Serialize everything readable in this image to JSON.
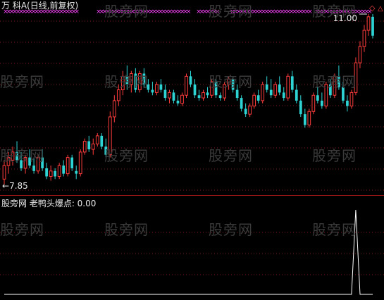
{
  "header": {
    "title": "万 科A(日线,前复权)"
  },
  "indicator": {
    "label": "股旁网 老鸭头爆点: 0.00"
  },
  "watermark": "股旁网",
  "colors": {
    "up": "#ff3c3c",
    "down": "#2ed3d3",
    "grid": "#7a1c1c",
    "marker": "#ff44ff",
    "indicator_line": "#ffffff",
    "divider": "#a01818"
  },
  "chart_data": {
    "type": "candlestick",
    "annotations": {
      "high_label": "11.00",
      "low_label": "7.85"
    },
    "price_range": [
      7.85,
      11.0
    ],
    "candles": [
      {
        "o": 7.95,
        "h": 8.3,
        "l": 7.85,
        "c": 8.2
      },
      {
        "o": 8.2,
        "h": 8.45,
        "l": 8.05,
        "c": 8.35
      },
      {
        "o": 8.3,
        "h": 8.55,
        "l": 8.2,
        "c": 8.45
      },
      {
        "o": 8.45,
        "h": 8.65,
        "l": 8.25,
        "c": 8.3
      },
      {
        "o": 8.3,
        "h": 8.45,
        "l": 8.1,
        "c": 8.15
      },
      {
        "o": 8.15,
        "h": 8.4,
        "l": 8.05,
        "c": 8.35
      },
      {
        "o": 8.35,
        "h": 8.5,
        "l": 8.15,
        "c": 8.2
      },
      {
        "o": 8.2,
        "h": 8.35,
        "l": 8.05,
        "c": 8.1
      },
      {
        "o": 8.1,
        "h": 8.4,
        "l": 8.05,
        "c": 8.35
      },
      {
        "o": 8.35,
        "h": 8.5,
        "l": 8.1,
        "c": 8.15
      },
      {
        "o": 8.15,
        "h": 8.25,
        "l": 7.95,
        "c": 8.0
      },
      {
        "o": 8.0,
        "h": 8.2,
        "l": 7.92,
        "c": 8.1
      },
      {
        "o": 8.1,
        "h": 8.15,
        "l": 7.95,
        "c": 8.0
      },
      {
        "o": 8.0,
        "h": 8.25,
        "l": 7.95,
        "c": 8.2
      },
      {
        "o": 8.2,
        "h": 8.3,
        "l": 8.0,
        "c": 8.05
      },
      {
        "o": 8.05,
        "h": 8.4,
        "l": 8.0,
        "c": 8.35
      },
      {
        "o": 8.35,
        "h": 8.4,
        "l": 8.1,
        "c": 8.15
      },
      {
        "o": 8.1,
        "h": 8.2,
        "l": 7.95,
        "c": 8.05
      },
      {
        "o": 8.05,
        "h": 8.5,
        "l": 8.0,
        "c": 8.45
      },
      {
        "o": 8.45,
        "h": 8.7,
        "l": 8.4,
        "c": 8.65
      },
      {
        "o": 8.65,
        "h": 8.75,
        "l": 8.45,
        "c": 8.5
      },
      {
        "o": 8.5,
        "h": 8.7,
        "l": 8.4,
        "c": 8.6
      },
      {
        "o": 8.6,
        "h": 8.8,
        "l": 8.55,
        "c": 8.75
      },
      {
        "o": 8.75,
        "h": 8.8,
        "l": 8.5,
        "c": 8.55
      },
      {
        "o": 8.55,
        "h": 8.7,
        "l": 8.35,
        "c": 8.4
      },
      {
        "o": 8.4,
        "h": 9.2,
        "l": 8.35,
        "c": 9.1
      },
      {
        "o": 9.1,
        "h": 9.5,
        "l": 9.0,
        "c": 9.4
      },
      {
        "o": 9.4,
        "h": 9.7,
        "l": 9.3,
        "c": 9.6
      },
      {
        "o": 9.6,
        "h": 9.95,
        "l": 9.5,
        "c": 9.85
      },
      {
        "o": 9.85,
        "h": 10.05,
        "l": 9.6,
        "c": 9.7
      },
      {
        "o": 9.7,
        "h": 9.95,
        "l": 9.55,
        "c": 9.9
      },
      {
        "o": 9.9,
        "h": 10.0,
        "l": 9.55,
        "c": 9.6
      },
      {
        "o": 9.6,
        "h": 9.95,
        "l": 9.55,
        "c": 9.9
      },
      {
        "o": 9.9,
        "h": 10.0,
        "l": 9.65,
        "c": 9.7
      },
      {
        "o": 9.7,
        "h": 9.8,
        "l": 9.55,
        "c": 9.6
      },
      {
        "o": 9.6,
        "h": 9.75,
        "l": 9.5,
        "c": 9.55
      },
      {
        "o": 9.55,
        "h": 9.75,
        "l": 9.5,
        "c": 9.7
      },
      {
        "o": 9.7,
        "h": 9.8,
        "l": 9.55,
        "c": 9.6
      },
      {
        "o": 9.6,
        "h": 9.7,
        "l": 9.4,
        "c": 9.45
      },
      {
        "o": 9.45,
        "h": 9.6,
        "l": 9.35,
        "c": 9.55
      },
      {
        "o": 9.55,
        "h": 9.6,
        "l": 9.35,
        "c": 9.4
      },
      {
        "o": 9.4,
        "h": 9.5,
        "l": 9.3,
        "c": 9.35
      },
      {
        "o": 9.35,
        "h": 9.55,
        "l": 9.3,
        "c": 9.5
      },
      {
        "o": 9.5,
        "h": 9.9,
        "l": 9.45,
        "c": 9.85
      },
      {
        "o": 9.85,
        "h": 9.95,
        "l": 9.65,
        "c": 9.7
      },
      {
        "o": 9.7,
        "h": 9.8,
        "l": 9.45,
        "c": 9.5
      },
      {
        "o": 9.5,
        "h": 9.6,
        "l": 9.4,
        "c": 9.45
      },
      {
        "o": 9.45,
        "h": 9.6,
        "l": 9.4,
        "c": 9.55
      },
      {
        "o": 9.55,
        "h": 9.65,
        "l": 9.45,
        "c": 9.5
      },
      {
        "o": 9.5,
        "h": 9.8,
        "l": 9.45,
        "c": 9.75
      },
      {
        "o": 9.75,
        "h": 9.8,
        "l": 9.45,
        "c": 9.5
      },
      {
        "o": 9.5,
        "h": 9.55,
        "l": 9.4,
        "c": 9.45
      },
      {
        "o": 9.45,
        "h": 9.75,
        "l": 9.4,
        "c": 9.7
      },
      {
        "o": 9.7,
        "h": 9.85,
        "l": 9.6,
        "c": 9.8
      },
      {
        "o": 9.8,
        "h": 9.85,
        "l": 9.55,
        "c": 9.6
      },
      {
        "o": 9.6,
        "h": 9.7,
        "l": 9.4,
        "c": 9.45
      },
      {
        "o": 9.45,
        "h": 9.5,
        "l": 9.2,
        "c": 9.25
      },
      {
        "o": 9.25,
        "h": 9.35,
        "l": 9.1,
        "c": 9.15
      },
      {
        "o": 9.15,
        "h": 9.35,
        "l": 9.1,
        "c": 9.3
      },
      {
        "o": 9.3,
        "h": 9.55,
        "l": 9.25,
        "c": 9.5
      },
      {
        "o": 9.5,
        "h": 9.6,
        "l": 9.35,
        "c": 9.4
      },
      {
        "o": 9.4,
        "h": 9.75,
        "l": 9.35,
        "c": 9.7
      },
      {
        "o": 9.7,
        "h": 9.85,
        "l": 9.55,
        "c": 9.6
      },
      {
        "o": 9.6,
        "h": 9.8,
        "l": 9.45,
        "c": 9.5
      },
      {
        "o": 9.5,
        "h": 9.75,
        "l": 9.45,
        "c": 9.7
      },
      {
        "o": 9.7,
        "h": 9.85,
        "l": 9.5,
        "c": 9.55
      },
      {
        "o": 9.55,
        "h": 9.65,
        "l": 9.4,
        "c": 9.45
      },
      {
        "o": 9.45,
        "h": 9.9,
        "l": 9.4,
        "c": 9.85
      },
      {
        "o": 9.85,
        "h": 9.95,
        "l": 9.55,
        "c": 9.6
      },
      {
        "o": 9.6,
        "h": 9.7,
        "l": 9.35,
        "c": 9.4
      },
      {
        "o": 9.4,
        "h": 9.5,
        "l": 9.1,
        "c": 9.15
      },
      {
        "o": 9.15,
        "h": 9.25,
        "l": 8.9,
        "c": 8.95
      },
      {
        "o": 8.95,
        "h": 9.25,
        "l": 8.9,
        "c": 9.2
      },
      {
        "o": 9.2,
        "h": 9.55,
        "l": 9.15,
        "c": 9.5
      },
      {
        "o": 9.5,
        "h": 9.65,
        "l": 9.35,
        "c": 9.4
      },
      {
        "o": 9.4,
        "h": 9.55,
        "l": 9.25,
        "c": 9.3
      },
      {
        "o": 9.3,
        "h": 9.75,
        "l": 9.25,
        "c": 9.7
      },
      {
        "o": 9.7,
        "h": 9.8,
        "l": 9.45,
        "c": 9.5
      },
      {
        "o": 9.5,
        "h": 9.9,
        "l": 9.45,
        "c": 9.85
      },
      {
        "o": 9.85,
        "h": 10.05,
        "l": 9.6,
        "c": 9.65
      },
      {
        "o": 9.65,
        "h": 9.75,
        "l": 9.35,
        "c": 9.4
      },
      {
        "o": 9.4,
        "h": 9.5,
        "l": 9.2,
        "c": 9.3
      },
      {
        "o": 9.3,
        "h": 9.6,
        "l": 9.25,
        "c": 9.55
      },
      {
        "o": 9.55,
        "h": 10.2,
        "l": 9.5,
        "c": 10.1
      },
      {
        "o": 10.1,
        "h": 10.5,
        "l": 10.0,
        "c": 10.4
      },
      {
        "o": 10.4,
        "h": 10.8,
        "l": 10.3,
        "c": 10.7
      },
      {
        "o": 10.7,
        "h": 11.0,
        "l": 10.6,
        "c": 10.95
      },
      {
        "o": 10.95,
        "h": 11.0,
        "l": 10.55,
        "c": 10.6
      }
    ],
    "indicator": {
      "name": "老鸭头爆点",
      "current_value": 0.0,
      "values": [
        0,
        0,
        0,
        0,
        0,
        0,
        0,
        0,
        0,
        0,
        0,
        0,
        0,
        0,
        0,
        0,
        0,
        0,
        0,
        0,
        0,
        0,
        0,
        0,
        0,
        0,
        0,
        0,
        0,
        0,
        0,
        0,
        0,
        0,
        0,
        0,
        0,
        0,
        0,
        0,
        0,
        0,
        0,
        0,
        0,
        0,
        0,
        0,
        0,
        0,
        0,
        0,
        0,
        0,
        0,
        0,
        0,
        0,
        0,
        0,
        0,
        0,
        0,
        0,
        0,
        0,
        0,
        0,
        0,
        0,
        0,
        0,
        0,
        0,
        0,
        0,
        0,
        0,
        0,
        0,
        0,
        0,
        0,
        1,
        0,
        0,
        0,
        0
      ]
    },
    "markers": {
      "symbol": "×",
      "row": "top",
      "color": "#ff44ff"
    }
  }
}
